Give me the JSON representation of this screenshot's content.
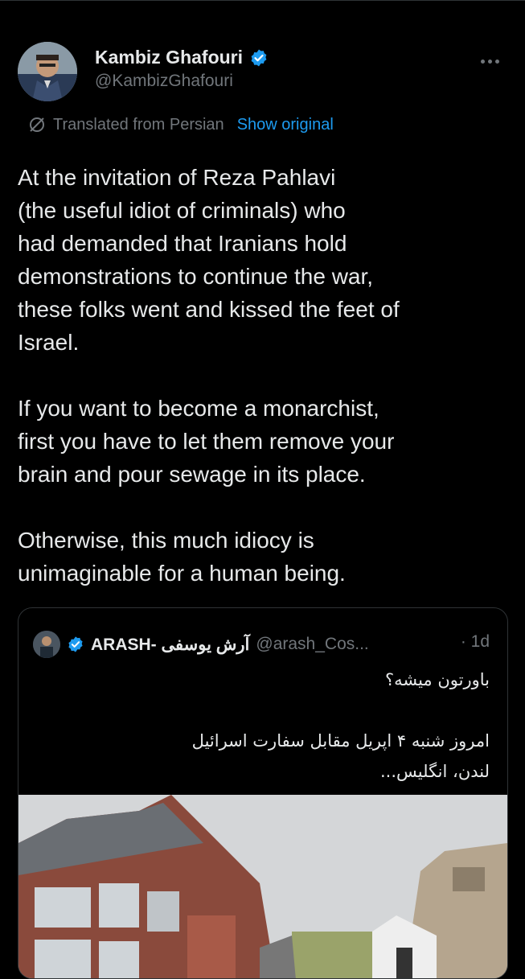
{
  "author": {
    "name": "Kambiz Ghafouri",
    "handle": "@KambizGhafouri",
    "verified": true
  },
  "translation": {
    "label": "Translated from Persian",
    "action": "Show original"
  },
  "tweet": {
    "text": "At the invitation of Reza Pahlavi\n(the useful idiot of criminals) who\nhad demanded that Iranians hold\ndemonstrations to continue the war,\nthese folks went and kissed the feet of\nIsrael.\n\nIf you want to become a monarchist,\nfirst you have to let them remove your\nbrain and pour sewage in its place.\n\nOtherwise, this much idiocy is\nunimaginable for a human being."
  },
  "quote": {
    "name": "ARASH- آرش یوسفی",
    "handle": "@arash_Cos...",
    "time": "· 1d",
    "text": "باورتون میشه؟\n\nامروز شنبه ۴ اپریل مقابل سفارت اسرائیل\nلندن، انگلیس..."
  },
  "colors": {
    "accent": "#1d9bf0",
    "muted": "#71767b",
    "text": "#e7e9ea",
    "background": "#000000"
  },
  "icons": [
    "verified-badge-icon",
    "more-icon",
    "translate-icon"
  ]
}
